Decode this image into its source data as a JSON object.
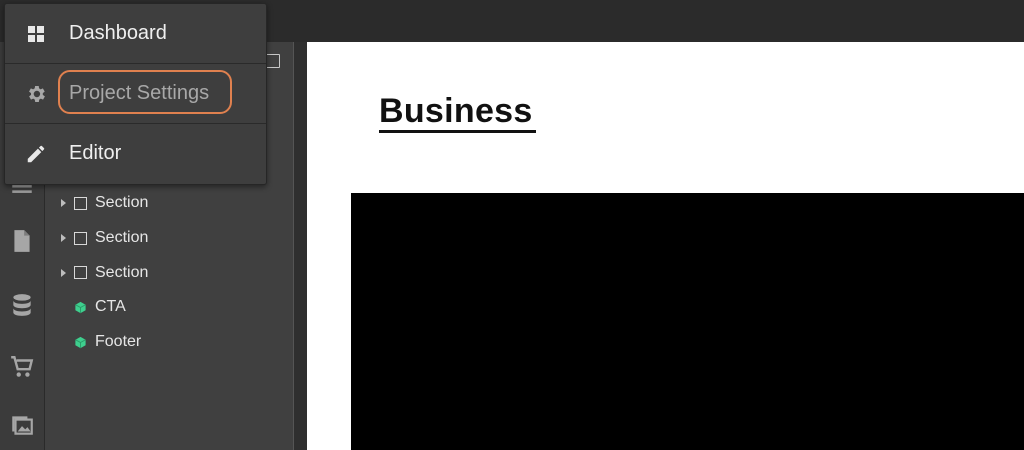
{
  "menu": {
    "items": [
      {
        "label": "Dashboard",
        "icon": "grid-icon"
      },
      {
        "label": "Project Settings",
        "icon": "gear-icon"
      },
      {
        "label": "Editor",
        "icon": "pencil-icon"
      }
    ]
  },
  "navigator": {
    "items": [
      {
        "label": "Section",
        "type": "section"
      },
      {
        "label": "Section",
        "type": "section"
      },
      {
        "label": "Section",
        "type": "section"
      },
      {
        "label": "CTA",
        "type": "component"
      },
      {
        "label": "Footer",
        "type": "component"
      }
    ]
  },
  "rail": {
    "icons": [
      "menu-icon",
      "pages-icon",
      "cms-icon",
      "ecommerce-icon",
      "assets-icon"
    ]
  },
  "canvas": {
    "heading": "Business"
  },
  "colors": {
    "highlight": "#e0814f",
    "component_green": "#3ecf8e"
  }
}
